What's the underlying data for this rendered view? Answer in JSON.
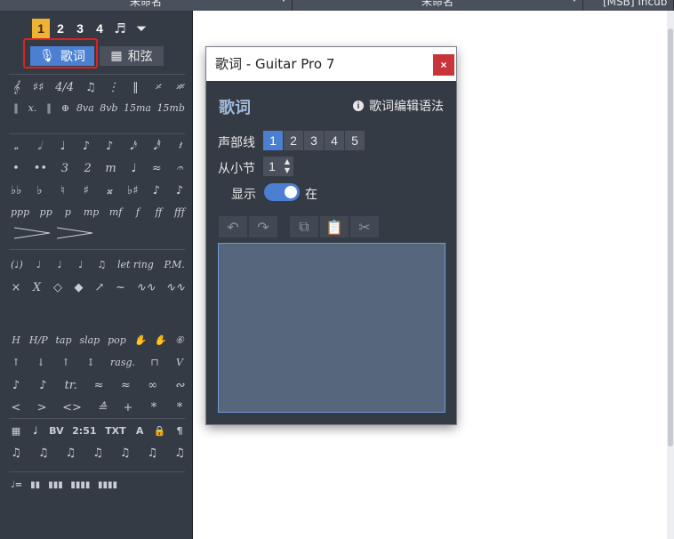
{
  "top_tabs": [
    {
      "label": "未命名"
    },
    {
      "label": "未命名"
    },
    {
      "label": "[MSB] Incub"
    }
  ],
  "palette": {
    "voices": [
      "1",
      "2",
      "3",
      "4"
    ],
    "lyrics_button": "歌词",
    "chord_button": "和弦",
    "rows": [
      [
        "𝄞",
        "♯♯",
        "4/4",
        "♫",
        "⋮",
        "‖",
        "𝄎",
        "𝄏"
      ],
      [
        "‖",
        "x.",
        "‖",
        "⊕",
        "8va",
        "8vb",
        "15ma",
        "15mb"
      ],
      [
        "𝅝",
        "𝅗𝅥",
        "♩",
        "♪",
        "♪",
        "𝅘𝅥𝅯",
        "𝅘𝅥𝅰",
        "𝄽"
      ],
      [
        "•",
        "••",
        "3",
        "2",
        "m",
        "♩",
        "≈",
        "𝄐"
      ],
      [
        "♭♭",
        "♭",
        "♮",
        "♯",
        "𝄪",
        "♭♯",
        "♪",
        "♪"
      ],
      [
        "ppp",
        "pp",
        "p",
        "mp",
        "mf",
        "f",
        "ff",
        "fff"
      ],
      [
        "(♩)",
        "♩",
        "♩",
        "♩",
        "♫",
        "let ring",
        "P.M."
      ],
      [
        "×",
        "X",
        "◇",
        "◆",
        "↗",
        "~",
        "∿∿",
        "∿∿"
      ],
      [
        "H",
        "H/P",
        "tap",
        "slap",
        "pop",
        "✋",
        "✋",
        "⑥"
      ],
      [
        "↑",
        "↓",
        "↑",
        "↕",
        "rasg.",
        "⊓",
        "V"
      ],
      [
        "♪",
        "♪",
        "tr.",
        "≈",
        "≈",
        "∞",
        "∾"
      ],
      [
        "<",
        ">",
        "<>",
        "≙",
        "+",
        "*",
        "*"
      ],
      [
        "▦",
        "𝅘𝅥",
        "BV",
        "2:51",
        "TXT",
        "A",
        "🔒",
        "¶"
      ],
      [
        "♫",
        "♫",
        "♫",
        "♫",
        "♫",
        "♫",
        "♫"
      ],
      [
        "♩=",
        "▮▮",
        "▮▮▮",
        "▮▮▮▮",
        "▮▮▮▮"
      ]
    ]
  },
  "dialog": {
    "title": "歌词 - Guitar Pro 7",
    "close_label": "×",
    "heading": "歌词",
    "help_link": "歌词编辑语法",
    "track_label": "声部线",
    "tracks": [
      "1",
      "2",
      "3",
      "4",
      "5"
    ],
    "from_bar_label": "从小节",
    "from_bar_value": "1",
    "show_label": "显示",
    "show_suffix": "在",
    "lyrics_text": ""
  },
  "colors": {
    "accent_blue": "#4b7fd1",
    "active_voice": "#f0b232",
    "panel": "#353b44",
    "highlight_frame": "#e02020"
  }
}
